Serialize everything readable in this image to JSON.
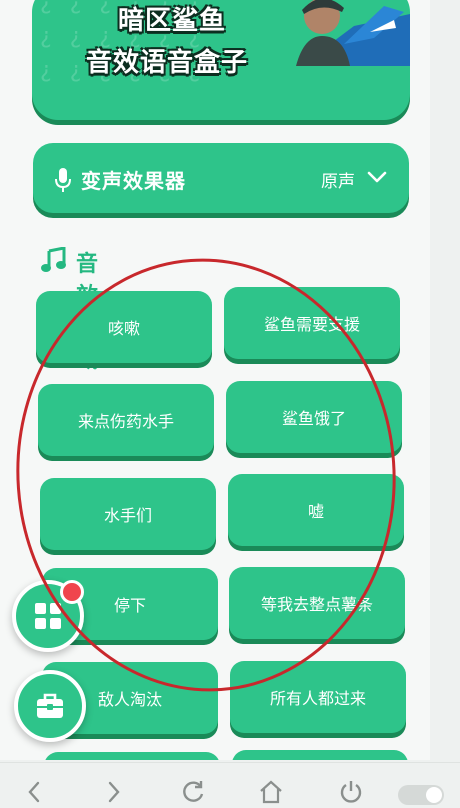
{
  "banner": {
    "title_line1": "暗区鲨鱼",
    "title_line2": "音效语音盒子",
    "pattern_glyph": "¿"
  },
  "voice_changer": {
    "icon": "mic-icon",
    "label": "变声效果器",
    "value": "原声",
    "chevron_icon": "chevron-down-icon"
  },
  "section": {
    "icon": "music-note-icon",
    "title": "音效区域"
  },
  "sounds": [
    {
      "label": "咳嗽"
    },
    {
      "label": "鲨鱼需要支援"
    },
    {
      "label": "来点伤药水手"
    },
    {
      "label": "鲨鱼饿了"
    },
    {
      "label": "水手们"
    },
    {
      "label": "嘘"
    },
    {
      "label": "停下"
    },
    {
      "label": "等我去整点薯条"
    },
    {
      "label": "敌人淘汰"
    },
    {
      "label": "所有人都过来"
    }
  ],
  "fabs": [
    {
      "icon": "grid-icon",
      "has_badge": true
    },
    {
      "icon": "toolbox-icon",
      "has_badge": false
    }
  ],
  "browser_nav": [
    "back-icon",
    "forward-icon",
    "reload-icon",
    "home-icon",
    "power-icon",
    "toggle"
  ],
  "colors": {
    "accent": "#2ec48a",
    "accent_dark": "#1a8a58",
    "heading": "#24b881",
    "annotation": "#c8282c",
    "badge": "#f0454d"
  }
}
